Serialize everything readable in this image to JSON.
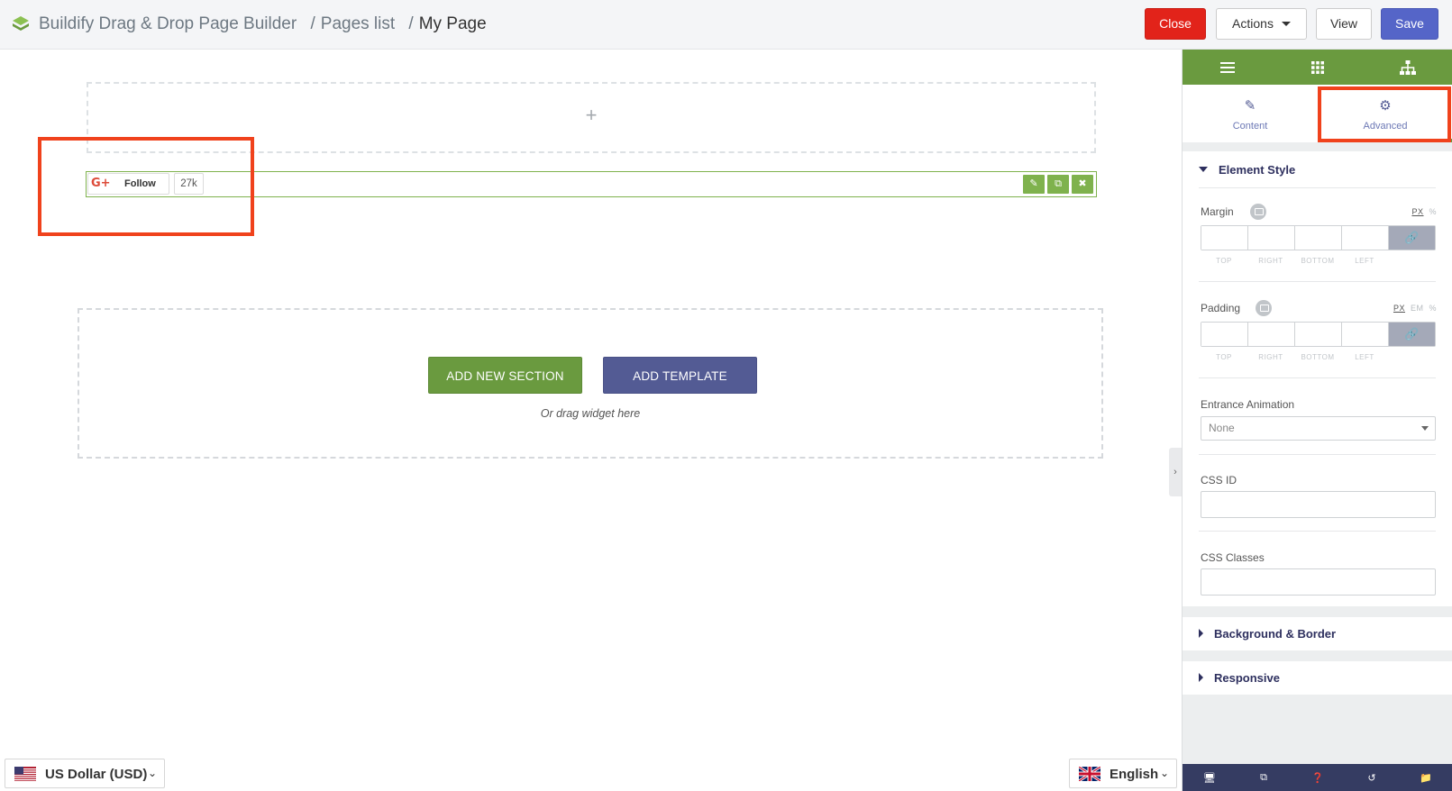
{
  "topbar": {
    "app_title": "Buildify Drag & Drop Page Builder",
    "crumb_sep_1": "/",
    "crumb_pages": "Pages list",
    "crumb_sep_2": "/",
    "crumb_current": "My Page",
    "close_label": "Close",
    "actions_label": "Actions",
    "view_label": "View",
    "save_label": "Save"
  },
  "canvas": {
    "plus_symbol": "+",
    "widget": {
      "gplus_logo": "G+",
      "follow_label": "Follow",
      "follow_count": "27k",
      "tools": [
        "pencil-icon",
        "duplicate-icon",
        "delete-icon"
      ]
    },
    "add_new_section_label": "ADD NEW SECTION",
    "add_template_label": "ADD TEMPLATE",
    "drag_hint": "Or drag widget here"
  },
  "footer": {
    "currency_label": "US Dollar (USD)",
    "language_label": "English"
  },
  "panel": {
    "header_icons": [
      "hamburger-menu-icon",
      "grid-apps-icon",
      "sitemap-icon"
    ],
    "tabs": [
      {
        "label": "Content",
        "icon": "pencil-icon",
        "active": false
      },
      {
        "label": "Advanced",
        "icon": "gear-icon",
        "active": true
      }
    ],
    "element_style": {
      "title": "Element Style",
      "margin_label": "Margin",
      "margin_units": [
        "PX",
        "%"
      ],
      "padding_label": "Padding",
      "padding_units": [
        "PX",
        "EM",
        "%"
      ],
      "dim_labels": [
        "TOP",
        "RIGHT",
        "BOTTOM",
        "LEFT"
      ],
      "entrance_animation_label": "Entrance Animation",
      "entrance_animation_value": "None",
      "css_id_label": "CSS ID",
      "css_classes_label": "CSS Classes"
    },
    "background_border_title": "Background & Border",
    "responsive_title": "Responsive",
    "footer_icons": [
      "desktop-icon",
      "navigator-icon",
      "help-icon",
      "history-icon",
      "folder-icon"
    ]
  },
  "colors": {
    "brand_green": "#6a9a3f",
    "accent_indigo": "#535b94",
    "close_red": "#e2231a",
    "save_blue": "#5565c8",
    "highlight_orange": "#f0421c"
  }
}
